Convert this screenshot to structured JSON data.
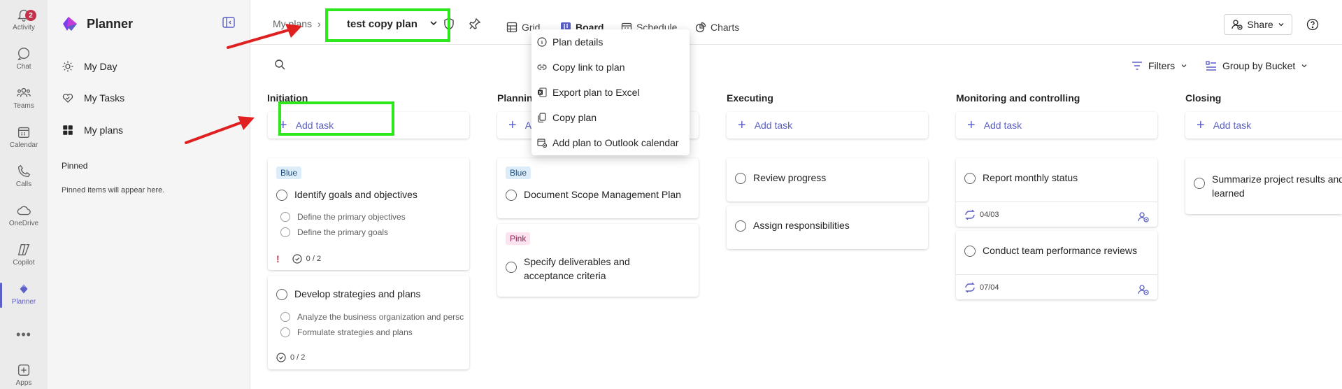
{
  "rail": {
    "items": [
      {
        "label": "Activity",
        "icon": "bell-icon",
        "badge": "2"
      },
      {
        "label": "Chat",
        "icon": "chat-icon"
      },
      {
        "label": "Teams",
        "icon": "teams-icon"
      },
      {
        "label": "Calendar",
        "icon": "calendar-icon"
      },
      {
        "label": "Calls",
        "icon": "phone-icon"
      },
      {
        "label": "OneDrive",
        "icon": "cloud-icon"
      },
      {
        "label": "Copilot",
        "icon": "copilot-icon"
      },
      {
        "label": "Planner",
        "icon": "planner-icon"
      },
      {
        "label": "Apps",
        "icon": "plus-box-icon"
      }
    ]
  },
  "sidebar": {
    "brand": "Planner",
    "nav": [
      {
        "label": "My Day",
        "icon": "sun-icon"
      },
      {
        "label": "My Tasks",
        "icon": "check-heart-icon"
      },
      {
        "label": "My plans",
        "icon": "grid-icon"
      }
    ],
    "pinned_heading": "Pinned",
    "pinned_empty": "Pinned items will appear here."
  },
  "header": {
    "breadcrumb": "My plans",
    "plan_title": "test copy plan",
    "tabs": [
      {
        "label": "Grid",
        "icon": "grid-table-icon"
      },
      {
        "label": "Board",
        "icon": "board-icon",
        "active": true
      },
      {
        "label": "Schedule",
        "icon": "schedule-icon"
      },
      {
        "label": "Charts",
        "icon": "charts-icon"
      }
    ],
    "share_label": "Share"
  },
  "toolbar": {
    "filters_label": "Filters",
    "group_label": "Group by Bucket"
  },
  "dropdown": {
    "items": [
      {
        "label": "Plan details",
        "icon": "info-icon"
      },
      {
        "label": "Copy link to plan",
        "icon": "link-icon"
      },
      {
        "label": "Export plan to Excel",
        "icon": "excel-icon"
      },
      {
        "label": "Copy plan",
        "icon": "copy-icon"
      },
      {
        "label": "Add plan to Outlook calendar",
        "icon": "calendar-add-icon"
      }
    ]
  },
  "buckets": [
    {
      "title": "Initiation",
      "add_label": "Add task"
    },
    {
      "title": "Planning",
      "add_label": "Add task"
    },
    {
      "title": "Executing",
      "add_label": "Add task"
    },
    {
      "title": "Monitoring and controlling",
      "add_label": "Add task"
    },
    {
      "title": "Closing",
      "add_label": "Add task"
    }
  ],
  "cards": {
    "c1": {
      "label": "Blue",
      "title": "Identify goals and objectives",
      "subs": [
        "Define the primary objectives",
        "Define the primary goals"
      ],
      "progress": "0 / 2"
    },
    "c2": {
      "title": "Develop strategies and plans",
      "subs": [
        "Analyze the business organization and persc",
        "Formulate strategies and plans"
      ],
      "progress": "0 / 2"
    },
    "c3": {
      "label": "Blue",
      "title": "Document Scope Management Plan"
    },
    "c4": {
      "label": "Pink",
      "title": "Specify deliverables and acceptance criteria"
    },
    "c5": {
      "title": "Review progress"
    },
    "c6": {
      "title": "Assign responsibilities"
    },
    "c7": {
      "title": "Report monthly status",
      "date": "04/03"
    },
    "c8": {
      "title": "Conduct team performance reviews",
      "date": "07/04"
    },
    "c9": {
      "title": "Summarize project results and lessons learned"
    }
  },
  "colors": {
    "accent": "#5b5fc7",
    "highlight": "#2ee81d",
    "arrow": "#e02020",
    "urgent": "#c4314b"
  }
}
